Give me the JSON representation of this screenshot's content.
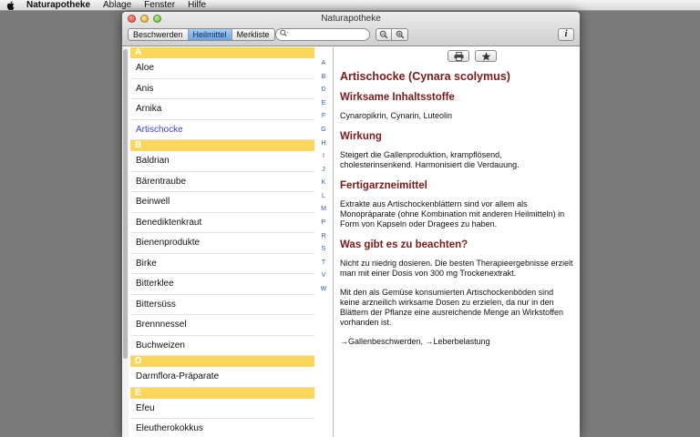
{
  "menubar": {
    "app": "Naturapotheke",
    "items": [
      "Ablage",
      "Fenster",
      "Hilfe"
    ]
  },
  "window": {
    "title": "Naturapotheke"
  },
  "toolbar": {
    "segments": [
      "Beschwerden",
      "Heilmittel",
      "Merkliste"
    ],
    "active_segment": "Heilmittel",
    "search": {
      "value": "",
      "placeholder": ""
    },
    "info_label": "i"
  },
  "list": {
    "sections": [
      {
        "letter": "A",
        "items": [
          "Aloe",
          "Anis",
          "Arnika",
          "Artischocke"
        ]
      },
      {
        "letter": "B",
        "items": [
          "Baldrian",
          "Bärentraube",
          "Beinwell",
          "Benediktenkraut",
          "Bienenprodukte",
          "Birke",
          "Bitterklee",
          "Bittersüss",
          "Brennnessel",
          "Buchweizen"
        ]
      },
      {
        "letter": "D",
        "items": [
          "Darmflora-Präparate"
        ]
      },
      {
        "letter": "E",
        "items": [
          "Efeu",
          "Eleutherokokkus"
        ]
      }
    ],
    "selected": "Artischocke",
    "alphabet": [
      "A",
      "B",
      "D",
      "E",
      "F",
      "G",
      "H",
      "I",
      "J",
      "K",
      "L",
      "M",
      "P",
      "R",
      "S",
      "T",
      "V",
      "W"
    ]
  },
  "detail": {
    "title": "Artischocke (Cynara scolymus)",
    "sections": [
      {
        "heading": "Wirksame Inhaltsstoffe",
        "paragraphs": [
          "Cynaropikrin, Cynarin, Luteolin"
        ]
      },
      {
        "heading": "Wirkung",
        "paragraphs": [
          "Steigert die Gallenproduktion, krampflösend, cholesterinsenkend. Harmonisiert die Verdauung."
        ]
      },
      {
        "heading": "Fertigarzneimittel",
        "paragraphs": [
          "Extrakte aus Artischockenblättern sind vor allem als Monopräparate (ohne Kombination mit anderen Heilmitteln) in Form von Kapseln oder Dragees zu haben."
        ]
      },
      {
        "heading": "Was gibt es zu beachten?",
        "paragraphs": [
          "Nicht zu niedrig dosieren. Die besten Therapieergebnisse erzielt man mit einer Dosis von 300 mg Trockenextrakt.",
          "Mit den als Gemüse konsumierten Artischockenböden sind keine arzneilich wirksame Dosen zu erzielen, da nur in den Blättern der Pflanze eine ausreichende Menge an Wirkstoffen vorhanden ist."
        ]
      }
    ],
    "links": "→Gallenbeschwerden, →Leberbelastung"
  },
  "colors": {
    "section_header": "#fad75a",
    "heading": "#7c1a1a",
    "selected_item": "#3a3fd0",
    "alphabet": "#2f56c8"
  }
}
